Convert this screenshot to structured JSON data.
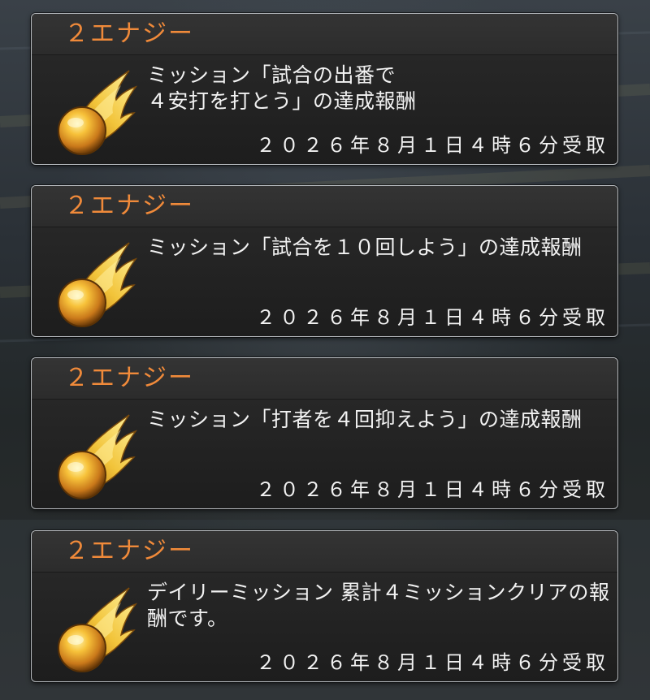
{
  "colors": {
    "title_accent": "#f08a3a",
    "text": "#f2f2f2",
    "card_border": "#b8bcc0",
    "card_bg": "#1f1f1f"
  },
  "rewards": [
    {
      "title": "２エナジー",
      "icon": "energy-fireball-icon",
      "description": "ミッション「試合の出番で\n４安打を打とう」の達成報酬",
      "date": "２０２６年８月１日４時６分受取"
    },
    {
      "title": "２エナジー",
      "icon": "energy-fireball-icon",
      "description": "ミッション「試合を１０回しよう」の達成報酬",
      "date": "２０２６年８月１日４時６分受取"
    },
    {
      "title": "２エナジー",
      "icon": "energy-fireball-icon",
      "description": "ミッション「打者を４回抑えよう」の達成報酬",
      "date": "２０２６年８月１日４時６分受取"
    },
    {
      "title": "２エナジー",
      "icon": "energy-fireball-icon",
      "description": "デイリーミッション 累計４ミッションクリアの報酬です。",
      "date": "２０２６年８月１日４時６分受取"
    }
  ]
}
